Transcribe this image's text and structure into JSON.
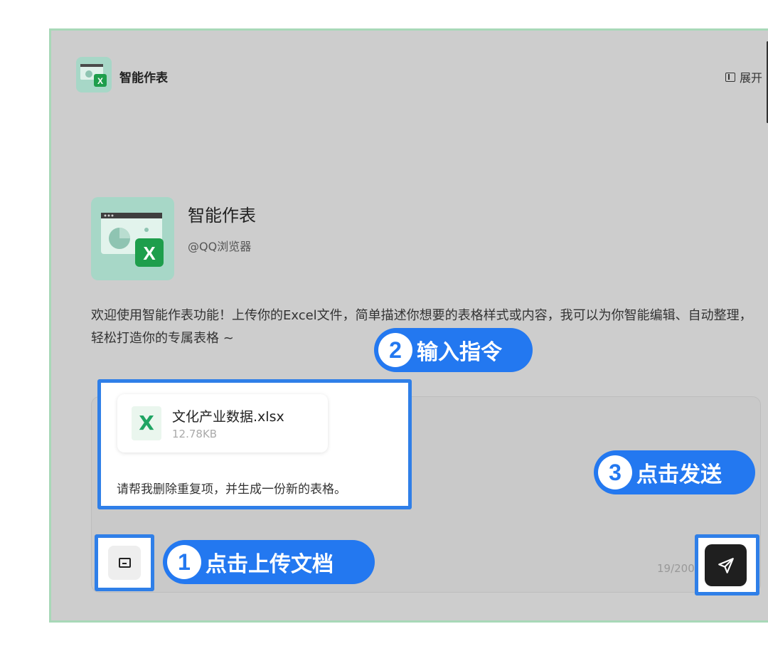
{
  "header": {
    "app_title": "智能作表",
    "expand_label": "展开",
    "logo_icon": "spreadsheet-app-icon"
  },
  "agent": {
    "name": "智能作表",
    "by": "@QQ浏览器",
    "intro": "欢迎使用智能作表功能！上传你的Excel文件，简单描述你想要的表格样式或内容，我可以为你智能编辑、自动整理，轻松打造你的专属表格 ~"
  },
  "composer": {
    "file": {
      "name": "文化产业数据.xlsx",
      "size": "12.78KB",
      "icon": "X"
    },
    "prompt": "请帮我删除重复项，并生成一份新的表格。",
    "counter": "19/200",
    "upload_icon": "folder-icon",
    "send_icon": "send-arrow-icon"
  },
  "annotations": {
    "step1": {
      "num": "1",
      "label": "点击上传文档"
    },
    "step2": {
      "num": "2",
      "label": "输入指令"
    },
    "step3": {
      "num": "3",
      "label": "点击发送"
    }
  },
  "colors": {
    "accent_blue": "#2378f0",
    "logo_bg": "#a7d7c7",
    "excel_green": "#1fa463",
    "frame_border": "#a8d8b8"
  }
}
